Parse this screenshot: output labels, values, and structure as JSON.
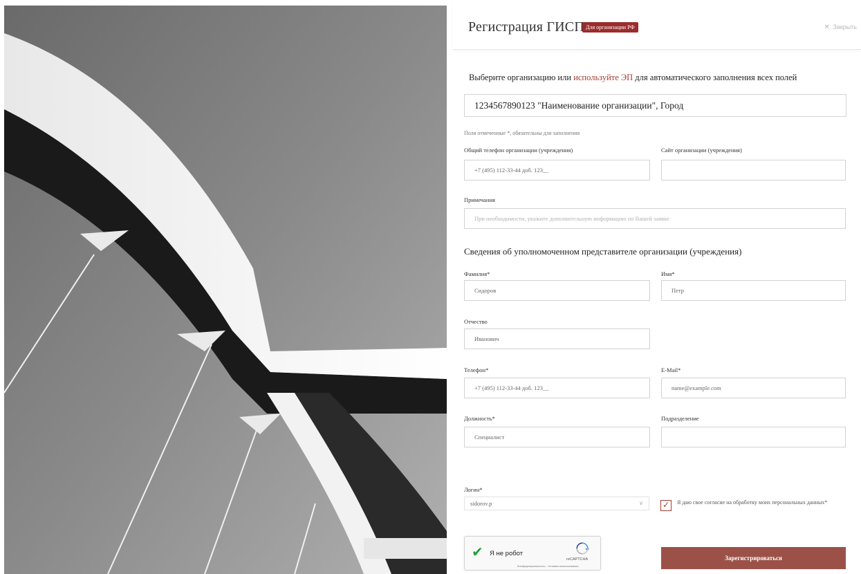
{
  "header": {
    "title": "Регистрация ГИСП",
    "badge": "Для организации РФ",
    "close_label": "Закрыть",
    "close_icon": "close-icon"
  },
  "lead": {
    "before": "Выберите организацию или ",
    "link": "используйте ЭП",
    "after": " для автоматического заполнения всех полей"
  },
  "organization": {
    "value": "1234567890123 \"Наименование организации\", Город"
  },
  "required_note": "Поля отмеченные *, обязательны для заполнения",
  "org_fields": {
    "phone_label": "Общий телефон организации (учреждения)",
    "phone_value": "+7 (495) 112-33-44 доб. 123__",
    "site_label": "Сайт организации (учреждения)",
    "site_value": "",
    "notes_label": "Примечания",
    "notes_placeholder": "При необходимости, укажите дополнительную информацию по Вашей заявке"
  },
  "representative": {
    "section_title": "Сведения об уполномоченном представителе организации (учреждения)",
    "last_name_label": "Фамилия*",
    "last_name_value": "Сидоров",
    "first_name_label": "Имя*",
    "first_name_value": "Петр",
    "middle_name_label": "Отчество",
    "middle_name_value": "Иванович",
    "phone_label": "Телефон*",
    "phone_value": "+7 (495) 112-33-44 доб. 123__",
    "email_label": "E-Mail*",
    "email_value": "name@example.com",
    "position_label": "Должность*",
    "position_value": "Специалист",
    "department_label": "Подразделение",
    "department_value": ""
  },
  "login": {
    "label": "Логин*",
    "value": "sidorov.p",
    "chevron_icon": "chevron-down-icon"
  },
  "consent": {
    "checked": true,
    "text": "Я даю свое согласие на обработку моих персональных данных*"
  },
  "captcha": {
    "label": "Я не робот",
    "brand": "reCAPTCHA",
    "terms": "Конфиденциальность - Условия использования",
    "check_icon": "checkmark-icon"
  },
  "submit_label": "Зарегистрироваться",
  "colors": {
    "accent": "#9b2c2c",
    "button": "#9c5148",
    "link": "#a33b32"
  }
}
